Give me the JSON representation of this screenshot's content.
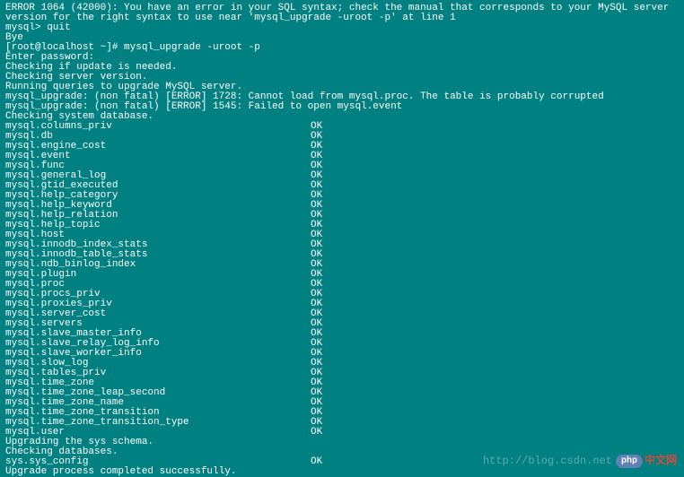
{
  "pre_lines": [
    "ERROR 1064 (42000): You have an error in your SQL syntax; check the manual that corresponds to your MySQL server",
    "version for the right syntax to use near 'mysql_upgrade -uroot -p' at line 1",
    "mysql> quit",
    "Bye",
    "[root@localhost ~]# mysql_upgrade -uroot -p",
    "Enter password:",
    "Checking if update is needed.",
    "Checking server version.",
    "Running queries to upgrade MySQL server.",
    "mysql_upgrade: (non fatal) [ERROR] 1728: Cannot load from mysql.proc. The table is probably corrupted",
    "mysql_upgrade: (non fatal) [ERROR] 1545: Failed to open mysql.event",
    "Checking system database."
  ],
  "tables": [
    {
      "name": "mysql.columns_priv",
      "status": "OK"
    },
    {
      "name": "mysql.db",
      "status": "OK"
    },
    {
      "name": "mysql.engine_cost",
      "status": "OK"
    },
    {
      "name": "mysql.event",
      "status": "OK"
    },
    {
      "name": "mysql.func",
      "status": "OK"
    },
    {
      "name": "mysql.general_log",
      "status": "OK"
    },
    {
      "name": "mysql.gtid_executed",
      "status": "OK"
    },
    {
      "name": "mysql.help_category",
      "status": "OK"
    },
    {
      "name": "mysql.help_keyword",
      "status": "OK"
    },
    {
      "name": "mysql.help_relation",
      "status": "OK"
    },
    {
      "name": "mysql.help_topic",
      "status": "OK"
    },
    {
      "name": "mysql.host",
      "status": "OK"
    },
    {
      "name": "mysql.innodb_index_stats",
      "status": "OK"
    },
    {
      "name": "mysql.innodb_table_stats",
      "status": "OK"
    },
    {
      "name": "mysql.ndb_binlog_index",
      "status": "OK"
    },
    {
      "name": "mysql.plugin",
      "status": "OK"
    },
    {
      "name": "mysql.proc",
      "status": "OK"
    },
    {
      "name": "mysql.procs_priv",
      "status": "OK"
    },
    {
      "name": "mysql.proxies_priv",
      "status": "OK"
    },
    {
      "name": "mysql.server_cost",
      "status": "OK"
    },
    {
      "name": "mysql.servers",
      "status": "OK"
    },
    {
      "name": "mysql.slave_master_info",
      "status": "OK"
    },
    {
      "name": "mysql.slave_relay_log_info",
      "status": "OK"
    },
    {
      "name": "mysql.slave_worker_info",
      "status": "OK"
    },
    {
      "name": "mysql.slow_log",
      "status": "OK"
    },
    {
      "name": "mysql.tables_priv",
      "status": "OK"
    },
    {
      "name": "mysql.time_zone",
      "status": "OK"
    },
    {
      "name": "mysql.time_zone_leap_second",
      "status": "OK"
    },
    {
      "name": "mysql.time_zone_name",
      "status": "OK"
    },
    {
      "name": "mysql.time_zone_transition",
      "status": "OK"
    },
    {
      "name": "mysql.time_zone_transition_type",
      "status": "OK"
    },
    {
      "name": "mysql.user",
      "status": "OK"
    }
  ],
  "mid_lines": [
    "Upgrading the sys schema.",
    "Checking databases."
  ],
  "tables2": [
    {
      "name": "sys.sys_config",
      "status": "OK"
    }
  ],
  "post_lines": [
    "Upgrade process completed successfully."
  ],
  "watermark": {
    "url": "http://blog.csdn.net",
    "php": "php",
    "cn": "中文网"
  }
}
